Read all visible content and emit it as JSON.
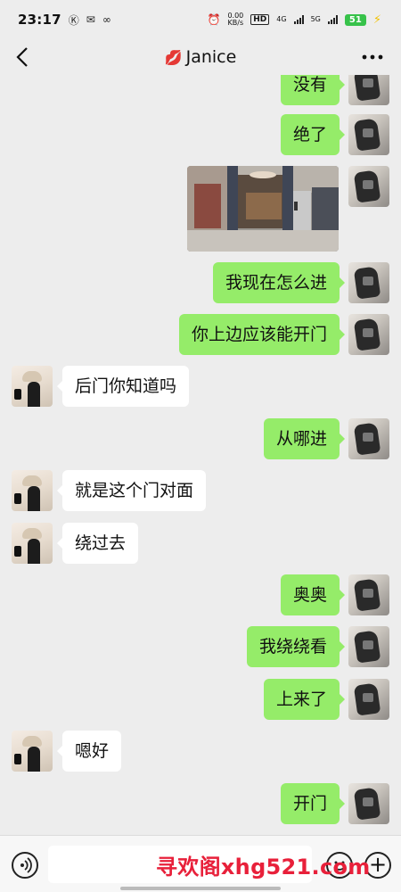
{
  "status_bar": {
    "time": "23:17",
    "left_icons": [
      "k-circle-icon",
      "message-icon",
      "infinity-icon"
    ],
    "speed_value": "0.00",
    "speed_unit": "KB/s",
    "hd_label": "HD",
    "net_4g": "4G",
    "net_5g": "5G",
    "battery_level": "51"
  },
  "nav": {
    "title": "Janice",
    "title_icon": "💋"
  },
  "messages": [
    {
      "side": "me",
      "text": "没有"
    },
    {
      "side": "me",
      "text": "绝了"
    },
    {
      "side": "me",
      "type": "image",
      "description": "photo-message"
    },
    {
      "side": "me",
      "text": "我现在怎么进"
    },
    {
      "side": "me",
      "text": "你上边应该能开门"
    },
    {
      "side": "them",
      "text": "后门你知道吗"
    },
    {
      "side": "me",
      "text": "从哪进"
    },
    {
      "side": "them",
      "text": "就是这个门对面"
    },
    {
      "side": "them",
      "text": "绕过去"
    },
    {
      "side": "me",
      "text": "奥奥"
    },
    {
      "side": "me",
      "text": "我绕绕看"
    },
    {
      "side": "me",
      "text": "上来了"
    },
    {
      "side": "them",
      "text": "嗯好"
    },
    {
      "side": "me",
      "text": "开门"
    }
  ],
  "input_bar": {
    "placeholder": "",
    "watermark": "寻欢阁xhg521.com"
  },
  "colors": {
    "background": "#ededed",
    "my_bubble": "#95ec69",
    "their_bubble": "#ffffff",
    "watermark": "#e8203a"
  }
}
